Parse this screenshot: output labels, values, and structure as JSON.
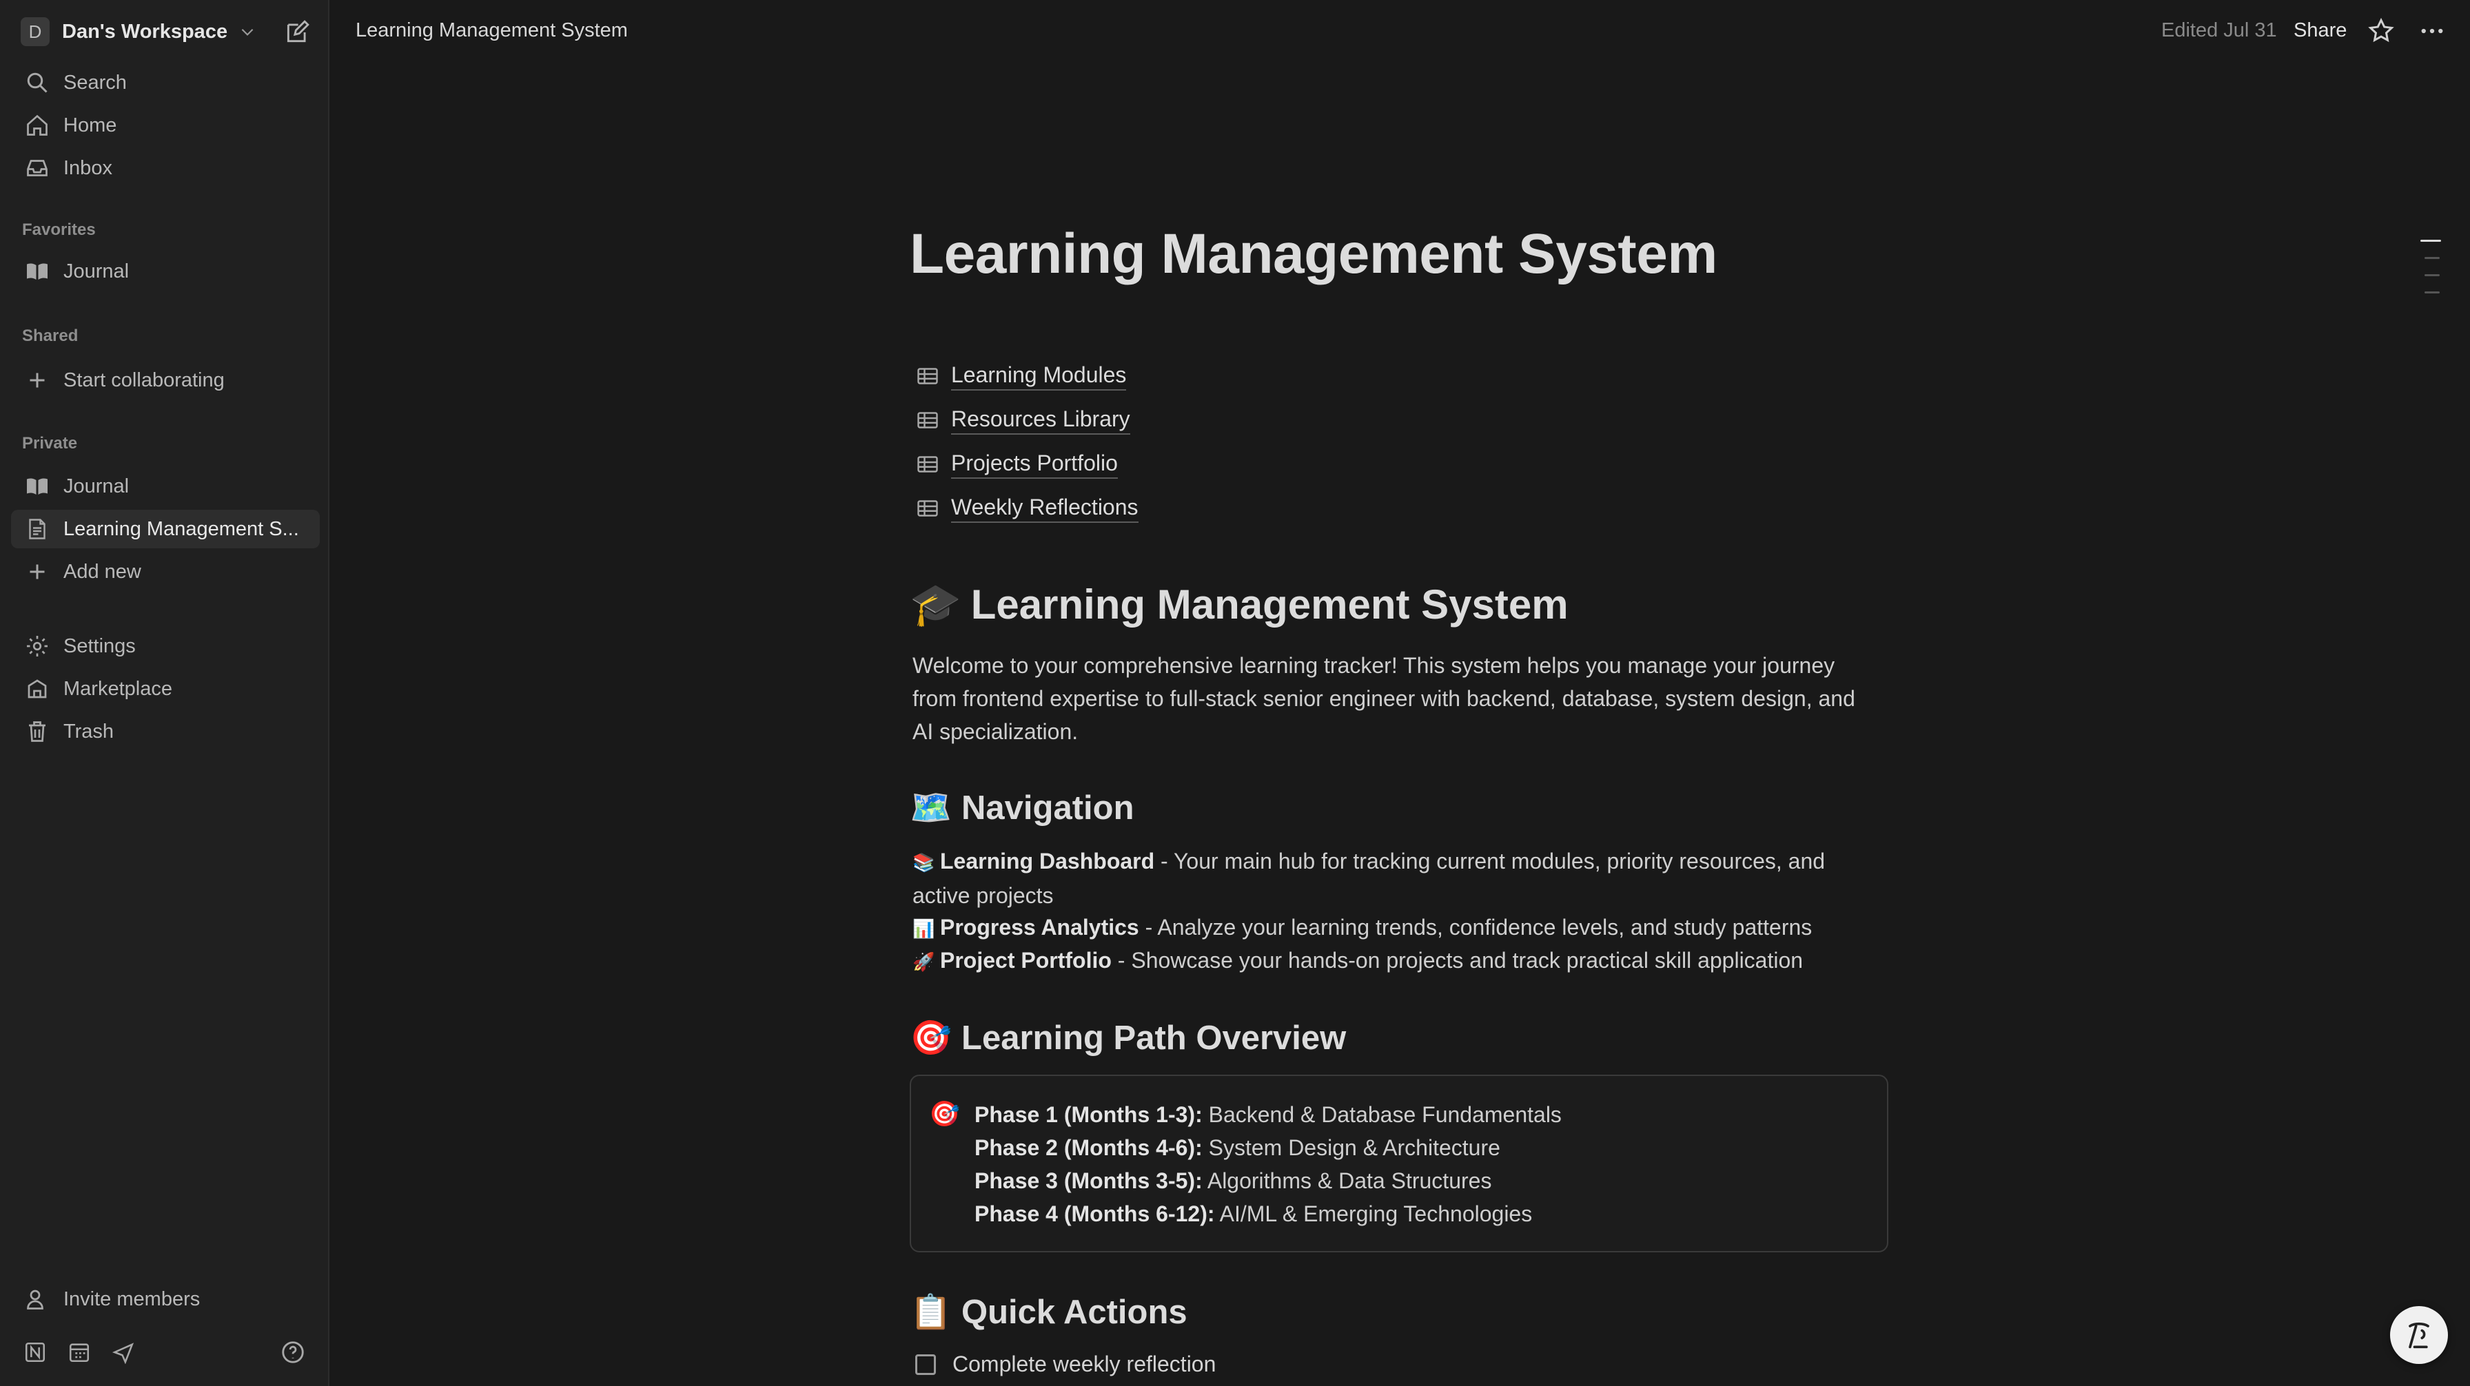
{
  "workspace": {
    "avatar_letter": "D",
    "name": "Dan's Workspace"
  },
  "sidebar": {
    "top_items": [
      {
        "label": "Search",
        "icon": "search-icon"
      },
      {
        "label": "Home",
        "icon": "home-icon"
      },
      {
        "label": "Inbox",
        "icon": "inbox-icon"
      }
    ],
    "favorites_label": "Favorites",
    "favorites": [
      {
        "label": "Journal",
        "icon": "book-icon"
      }
    ],
    "shared_label": "Shared",
    "shared": [
      {
        "label": "Start collaborating",
        "icon": "plus-icon"
      }
    ],
    "private_label": "Private",
    "private": [
      {
        "label": "Journal",
        "icon": "book-icon"
      },
      {
        "label": "Learning Management S...",
        "icon": "page-icon",
        "active": true
      },
      {
        "label": "Add new",
        "icon": "plus-icon"
      }
    ],
    "utility": [
      {
        "label": "Settings",
        "icon": "gear-icon"
      },
      {
        "label": "Marketplace",
        "icon": "marketplace-icon"
      },
      {
        "label": "Trash",
        "icon": "trash-icon"
      }
    ],
    "invite_label": "Invite members"
  },
  "topbar": {
    "breadcrumb": "Learning Management System",
    "edited": "Edited Jul 31",
    "share_label": "Share"
  },
  "page": {
    "title": "Learning Management System",
    "databases": [
      "Learning Modules",
      "Resources Library",
      "Projects Portfolio",
      "Weekly Reflections"
    ],
    "heading_main": {
      "emoji": "🎓",
      "text": "Learning Management System"
    },
    "intro": "Welcome to your comprehensive learning tracker! This system helps you manage your journey from frontend expertise to full-stack senior engineer with backend, database, system design, and AI specialization.",
    "nav_heading": {
      "emoji": "🗺️",
      "text": "Navigation"
    },
    "nav_items": [
      {
        "emoji": "📚",
        "title": "Learning Dashboard",
        "desc": " - Your main hub for tracking current modules, priority resources, and active projects"
      },
      {
        "emoji": "📊",
        "title": "Progress Analytics",
        "desc": " - Analyze your learning trends, confidence levels, and study patterns"
      },
      {
        "emoji": "🚀",
        "title": "Project Portfolio",
        "desc": " - Showcase your hands-on projects and track practical skill application"
      }
    ],
    "path_heading": {
      "emoji": "🎯",
      "text": "Learning Path Overview"
    },
    "callout_emoji": "🎯",
    "phases": [
      {
        "label": "Phase 1 (Months 1-3):",
        "value": " Backend & Database Fundamentals"
      },
      {
        "label": "Phase 2 (Months 4-6):",
        "value": " System Design & Architecture"
      },
      {
        "label": "Phase 3 (Months 3-5):",
        "value": " Algorithms & Data Structures"
      },
      {
        "label": "Phase 4 (Months 6-12):",
        "value": " AI/ML & Emerging Technologies"
      }
    ],
    "actions_heading": {
      "emoji": "📋",
      "text": "Quick Actions"
    },
    "todos": [
      {
        "label": "Complete weekly reflection",
        "checked": false
      }
    ]
  }
}
